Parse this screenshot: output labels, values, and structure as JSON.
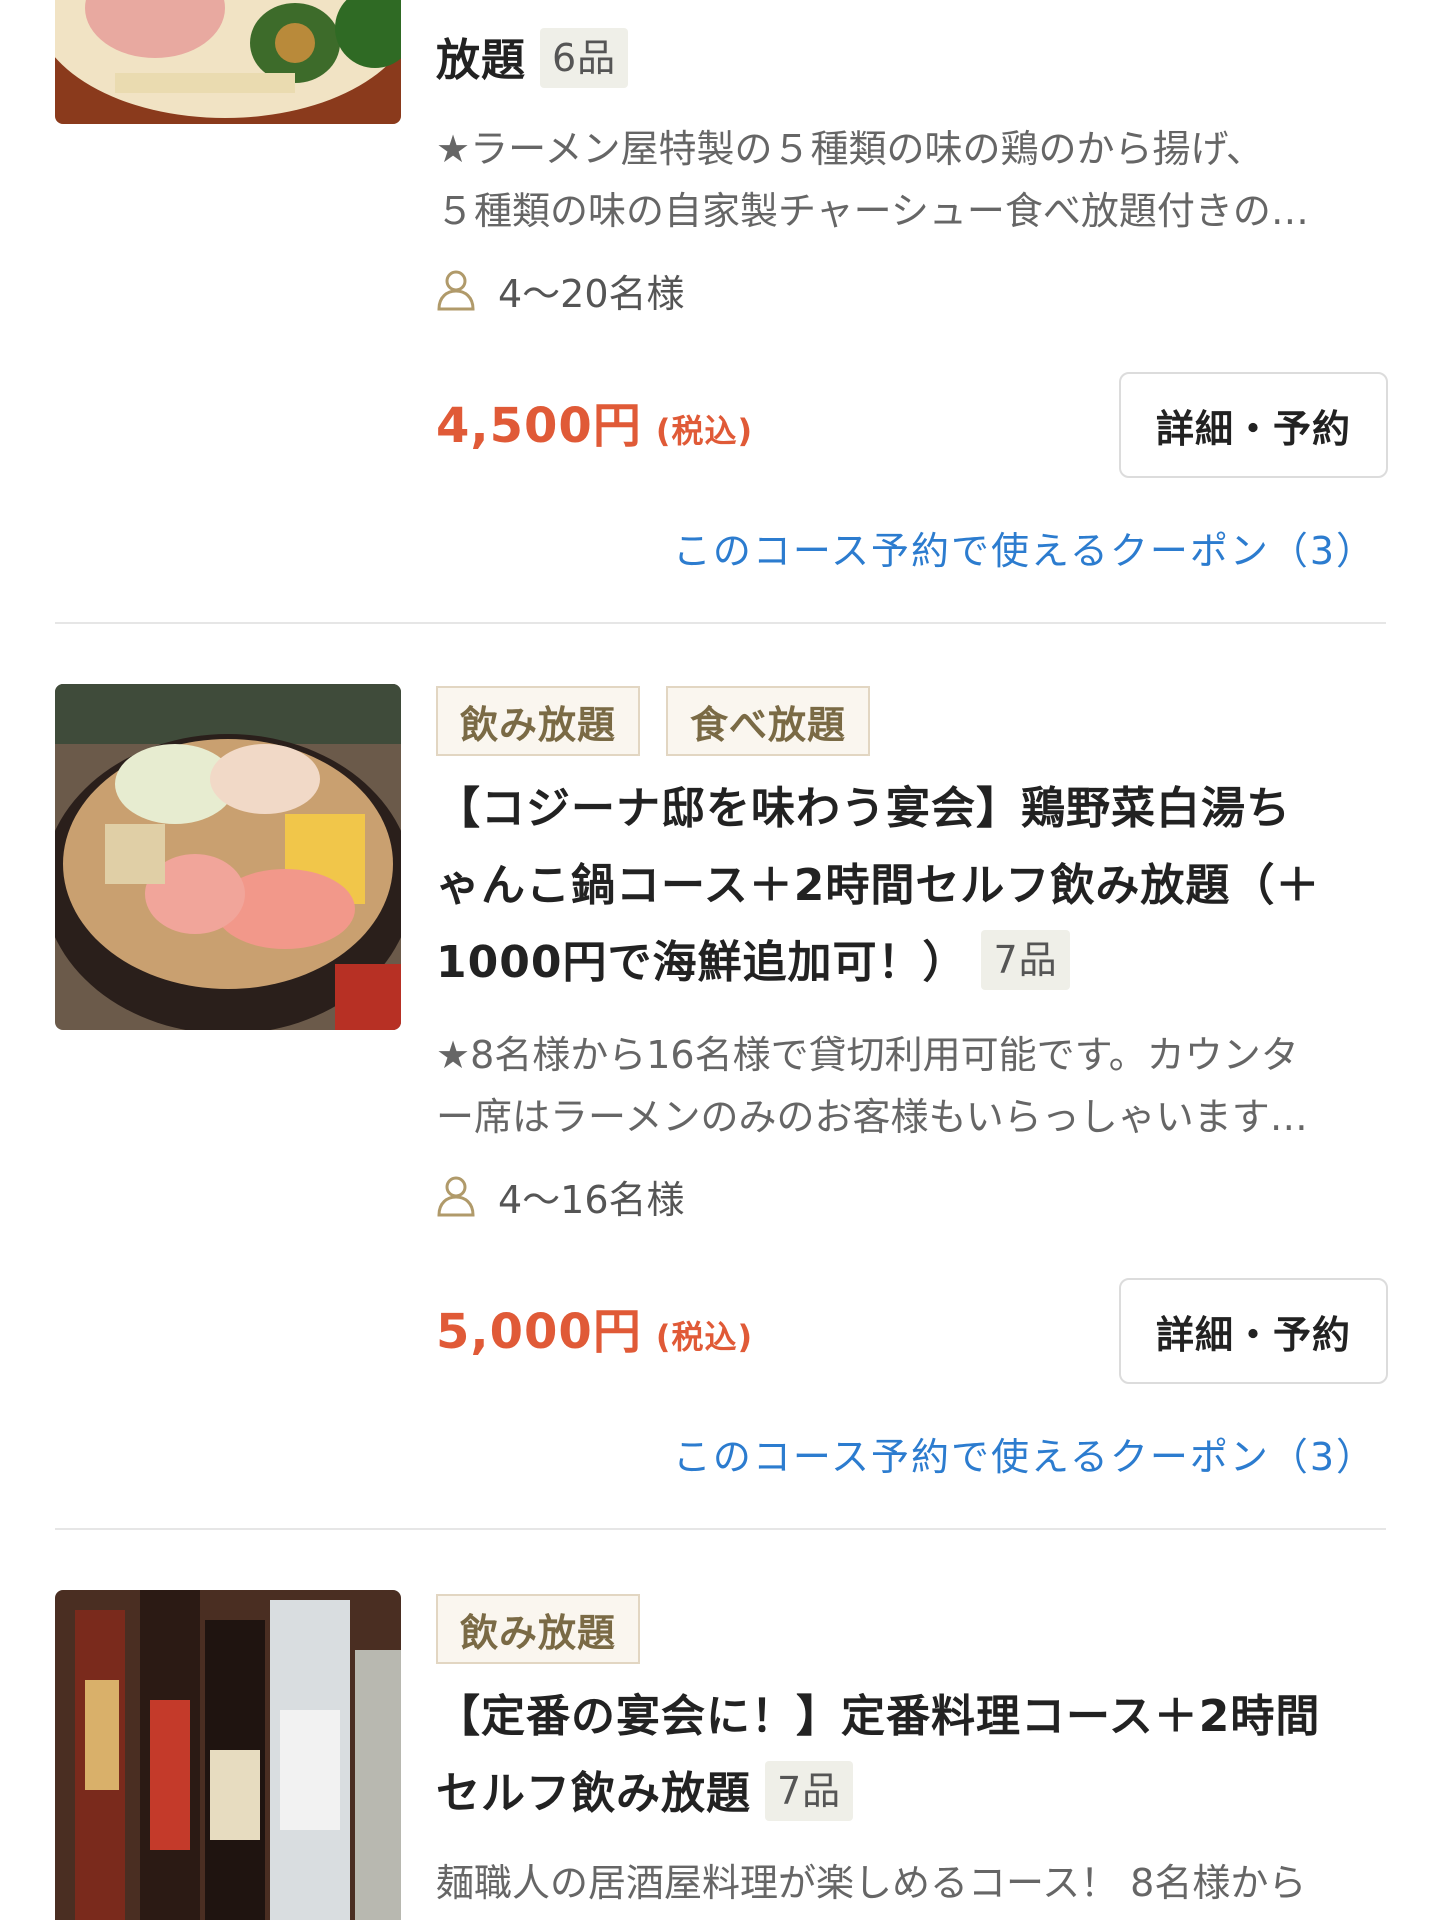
{
  "courses": [
    {
      "title_fragment": "放題",
      "items": "6品",
      "description_line1": "★ラーメン屋特製の５種類の味の鶏のから揚げ、",
      "description_line2": "５種類の味の自家製チャーシュー食べ放題付きの…",
      "capacity": "4〜20名様",
      "price": "4,500円",
      "tax": "(税込)",
      "detail_button": "詳細・予約",
      "coupon_link": "このコース予約で使えるクーポン（3）",
      "icon": "person-icon"
    },
    {
      "tags": [
        "飲み放題",
        "食べ放題"
      ],
      "title_line1": "【コジーナ邸を味わう宴会】鶏野菜白湯ち",
      "title_line2": "ゃんこ鍋コース＋2時間セルフ飲み放題（＋",
      "title_line3": "1000円で海鮮追加可！）",
      "items": "7品",
      "description_line1": "★8名様から16名様で貸切利用可能です。カウンタ",
      "description_line2": "ー席はラーメンのみのお客様もいらっしゃいます…",
      "capacity": "4〜16名様",
      "price": "5,000円",
      "tax": "(税込)",
      "detail_button": "詳細・予約",
      "coupon_link": "このコース予約で使えるクーポン（3）",
      "icon": "person-icon"
    },
    {
      "tags": [
        "飲み放題"
      ],
      "title_line1": "【定番の宴会に！】定番料理コース＋2時間",
      "title_line2": "セルフ飲み放題",
      "items": "7品",
      "description_line1": "麺職人の居酒屋料理が楽しめるコース！ 8名様から"
    }
  ]
}
